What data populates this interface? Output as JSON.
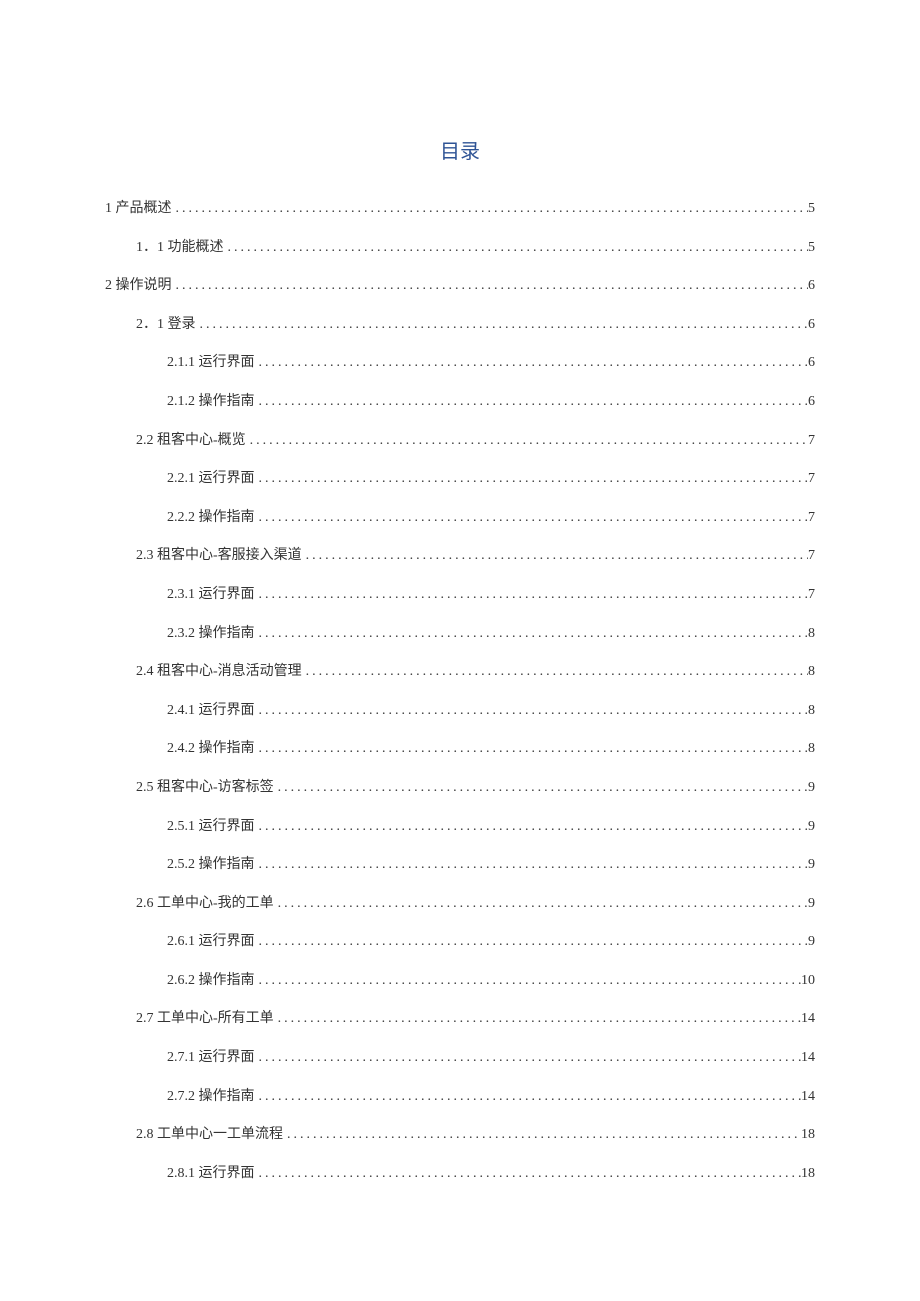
{
  "title": "目录",
  "entries": [
    {
      "level": 1,
      "label": "1 产品概述",
      "page": "5"
    },
    {
      "level": 2,
      "label": "1．1 功能概述",
      "page": "5"
    },
    {
      "level": 1,
      "label": "2 操作说明",
      "page": "6"
    },
    {
      "level": 2,
      "label": "2．1 登录",
      "page": "6"
    },
    {
      "level": 3,
      "label": "2.1.1 运行界面",
      "page": "6"
    },
    {
      "level": 3,
      "label": "2.1.2 操作指南",
      "page": "6"
    },
    {
      "level": 2,
      "label": "2.2 租客中心-概览",
      "page": "7"
    },
    {
      "level": 3,
      "label": "2.2.1 运行界面",
      "page": "7"
    },
    {
      "level": 3,
      "label": "2.2.2 操作指南",
      "page": "7"
    },
    {
      "level": 2,
      "label": "2.3 租客中心-客服接入渠道",
      "page": "7"
    },
    {
      "level": 3,
      "label": "2.3.1 运行界面",
      "page": "7"
    },
    {
      "level": 3,
      "label": "2.3.2 操作指南",
      "page": "8"
    },
    {
      "level": 2,
      "label": "2.4 租客中心-消息活动管理",
      "page": "8"
    },
    {
      "level": 3,
      "label": "2.4.1 运行界面",
      "page": "8"
    },
    {
      "level": 3,
      "label": "2.4.2 操作指南",
      "page": "8"
    },
    {
      "level": 2,
      "label": "2.5 租客中心-访客标签",
      "page": "9"
    },
    {
      "level": 3,
      "label": "2.5.1 运行界面",
      "page": "9"
    },
    {
      "level": 3,
      "label": "2.5.2 操作指南",
      "page": "9"
    },
    {
      "level": 2,
      "label": "2.6 工单中心-我的工单",
      "page": "9"
    },
    {
      "level": 3,
      "label": "2.6.1 运行界面",
      "page": "9"
    },
    {
      "level": 3,
      "label": "2.6.2 操作指南",
      "page": "10"
    },
    {
      "level": 2,
      "label": "2.7 工单中心-所有工单",
      "page": "14"
    },
    {
      "level": 3,
      "label": "2.7.1 运行界面",
      "page": "14"
    },
    {
      "level": 3,
      "label": "2.7.2 操作指南",
      "page": "14"
    },
    {
      "level": 2,
      "label": "2.8 工单中心一工单流程",
      "page": "18"
    },
    {
      "level": 3,
      "label": "2.8.1 运行界面",
      "page": "18"
    }
  ]
}
